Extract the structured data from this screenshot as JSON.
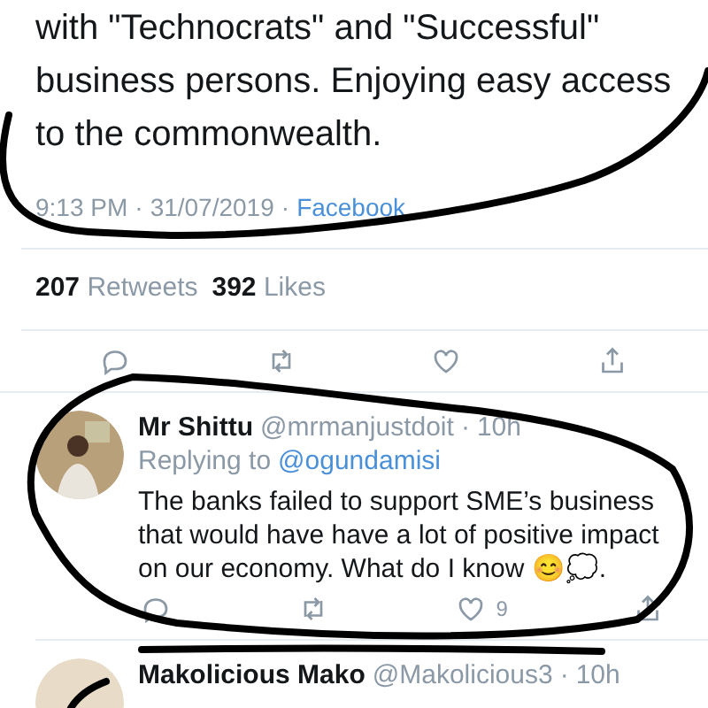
{
  "tweet": {
    "text_lines": [
      "with \"Technocrats\" and \"Successful\"",
      "business persons. Enjoying easy access",
      "to the commonwealth."
    ],
    "time": "9:13 PM",
    "sep": "·",
    "date": "31/07/2019",
    "sep2": "·",
    "source": "Facebook",
    "retweets": "207",
    "retweets_label": "Retweets",
    "likes": "392",
    "likes_label": "Likes"
  },
  "replies": [
    {
      "name": "Mr Shittu",
      "handle": "@mrmanjustdoit",
      "sep": "·",
      "age": "10h",
      "replying_label": "Replying to",
      "replying_to": "@ogundamisi",
      "text": "The banks failed to support SME’s business that would have have a lot of positive impact on our economy. What do I know 😊💭.",
      "like_count": "9"
    },
    {
      "name": "Makolicious Mako",
      "handle": "@Makolicious3",
      "sep": "·",
      "age": "10h"
    }
  ]
}
